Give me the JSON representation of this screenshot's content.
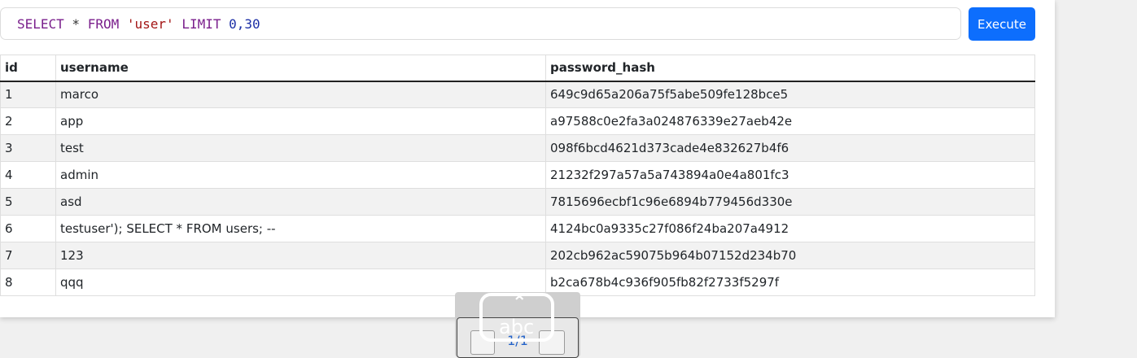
{
  "query": {
    "tokens": [
      {
        "text": "SELECT",
        "kind": "keyword"
      },
      {
        "text": " * ",
        "kind": "operator"
      },
      {
        "text": "FROM",
        "kind": "keyword"
      },
      {
        "text": " ",
        "kind": "operator"
      },
      {
        "text": "'user'",
        "kind": "string"
      },
      {
        "text": " ",
        "kind": "operator"
      },
      {
        "text": "LIMIT",
        "kind": "keyword"
      },
      {
        "text": " ",
        "kind": "operator"
      },
      {
        "text": "0,30",
        "kind": "number"
      }
    ]
  },
  "execute_label": "Execute",
  "table": {
    "columns": [
      "id",
      "username",
      "password_hash"
    ],
    "rows": [
      [
        "1",
        "marco",
        "649c9d65a206a75f5abe509fe128bce5"
      ],
      [
        "2",
        "app",
        "a97588c0e2fa3a024876339e27aeb42e"
      ],
      [
        "3",
        "test",
        "098f6bcd4621d373cade4e832627b4f6"
      ],
      [
        "4",
        "admin",
        "21232f297a57a5a743894a0e4a801fc3"
      ],
      [
        "5",
        "asd",
        "7815696ecbf1c96e6894b779456d330e"
      ],
      [
        "6",
        "testuser'); SELECT * FROM users; --",
        "4124bc0a9335c27f086f24ba207a4912"
      ],
      [
        "7",
        "123",
        "202cb962ac59075b964b07152d234b70"
      ],
      [
        "8",
        "qqq",
        "b2ca678b4c936f905fb82f2733f5297f"
      ]
    ]
  },
  "pager": {
    "label": "1/1"
  },
  "key_overlay": {
    "text": "abc"
  },
  "colors": {
    "accent": "#0d6efd",
    "keyword": "#7a1f8c",
    "string": "#a31515",
    "number": "#1c2fa6"
  }
}
